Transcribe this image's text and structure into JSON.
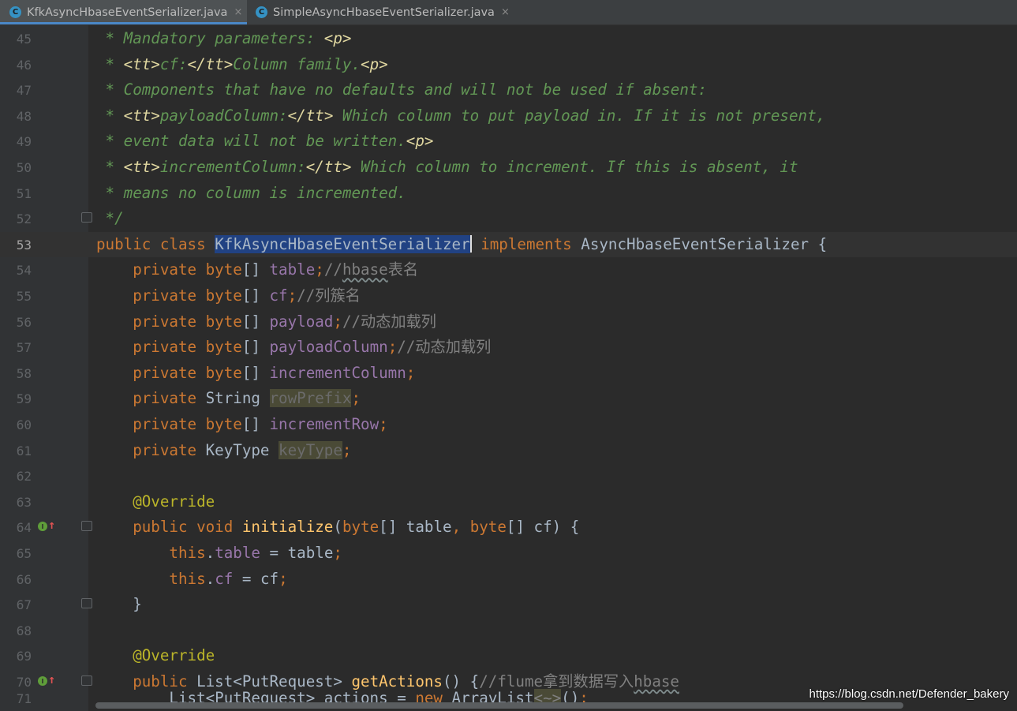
{
  "tabs": [
    {
      "label": "KfkAsyncHbaseEventSerializer.java",
      "icon": "class-icon",
      "icon_text": "C",
      "close": "×",
      "active": true
    },
    {
      "label": "SimpleAsyncHbaseEventSerializer.java",
      "icon": "class-icon",
      "icon_text": "C",
      "close": "×",
      "active": false
    }
  ],
  "colors": {
    "keyword": "#cc7832",
    "doc_comment": "#629755",
    "field": "#9876aa",
    "method": "#ffc66d",
    "annotation": "#bbb529",
    "selection": "#214283"
  },
  "gutter": {
    "override_marker_text": "I",
    "override_arrow": "↑"
  },
  "code": {
    "l45": {
      "num": "45",
      "t1": " * Mandatory parameters: ",
      "t2": "<p>"
    },
    "l46": {
      "num": "46",
      "t1": " * ",
      "t2": "<tt>",
      "t3": "cf:",
      "t4": "</tt>",
      "t5": "Column family.",
      "t6": "<p>"
    },
    "l47": {
      "num": "47",
      "t1": " * Components that have no defaults and will not be used if absent:"
    },
    "l48": {
      "num": "48",
      "t1": " * ",
      "t2": "<tt>",
      "t3": "payloadColumn:",
      "t4": "</tt>",
      "t5": " Which column to put payload in. If it is not present,"
    },
    "l49": {
      "num": "49",
      "t1": " * event data will not be written.",
      "t2": "<p>"
    },
    "l50": {
      "num": "50",
      "t1": " * ",
      "t2": "<tt>",
      "t3": "incrementColumn:",
      "t4": "</tt>",
      "t5": " Which column to increment. If this is absent, it"
    },
    "l51": {
      "num": "51",
      "t1": " * means no column is incremented."
    },
    "l52": {
      "num": "52",
      "t1": " */"
    },
    "l53": {
      "num": "53",
      "t1": "public class ",
      "t2": "KfkAsyncHbaseEventSerializer",
      "t3": " implements ",
      "t4": "AsyncHbaseEventSerializer {"
    },
    "l54": {
      "num": "54",
      "t1": "    private ",
      "t2": "byte",
      "t3": "[] ",
      "t4": "table",
      "t5": ";",
      "t6": "//",
      "t7": "hbase",
      "t8": "表名"
    },
    "l55": {
      "num": "55",
      "t1": "    private ",
      "t2": "byte",
      "t3": "[] ",
      "t4": "cf",
      "t5": ";",
      "t6": "//列簇名"
    },
    "l56": {
      "num": "56",
      "t1": "    private ",
      "t2": "byte",
      "t3": "[] ",
      "t4": "payload",
      "t5": ";",
      "t6": "//动态加载列"
    },
    "l57": {
      "num": "57",
      "t1": "    private ",
      "t2": "byte",
      "t3": "[] ",
      "t4": "payloadColumn",
      "t5": ";",
      "t6": "//动态加载列"
    },
    "l58": {
      "num": "58",
      "t1": "    private ",
      "t2": "byte",
      "t3": "[] ",
      "t4": "incrementColumn",
      "t5": ";"
    },
    "l59": {
      "num": "59",
      "t1": "    private ",
      "t2": "String ",
      "t3": "rowPrefix",
      "t4": ";"
    },
    "l60": {
      "num": "60",
      "t1": "    private ",
      "t2": "byte",
      "t3": "[] ",
      "t4": "incrementRow",
      "t5": ";"
    },
    "l61": {
      "num": "61",
      "t1": "    private ",
      "t2": "KeyType ",
      "t3": "keyType",
      "t4": ";"
    },
    "l62": {
      "num": "62"
    },
    "l63": {
      "num": "63",
      "t1": "    @Override"
    },
    "l64": {
      "num": "64",
      "t1": "    public void ",
      "t2": "initialize",
      "t3": "(",
      "t4": "byte",
      "t5": "[] table",
      "t6": ", ",
      "t7": "byte",
      "t8": "[] cf) {"
    },
    "l65": {
      "num": "65",
      "t1": "        this",
      "t2": ".",
      "t3": "table",
      "t4": " = table",
      "t5": ";"
    },
    "l66": {
      "num": "66",
      "t1": "        this",
      "t2": ".",
      "t3": "cf",
      "t4": " = cf",
      "t5": ";"
    },
    "l67": {
      "num": "67",
      "t1": "    }"
    },
    "l68": {
      "num": "68"
    },
    "l69": {
      "num": "69",
      "t1": "    @Override"
    },
    "l70": {
      "num": "70",
      "t1": "    public ",
      "t2": "List<PutRequest> ",
      "t3": "getActions",
      "t4": "() {",
      "t5": "//flume拿到数据写入",
      "t6": "hbase"
    },
    "l71": {
      "num": "71",
      "t1": "        List<PutRequest> actions = ",
      "t2": "new ",
      "t3": "ArrayList",
      "t4": "<~>",
      "t5": "()",
      "t6": ";"
    }
  },
  "watermark": "https://blog.csdn.net/Defender_bakery"
}
